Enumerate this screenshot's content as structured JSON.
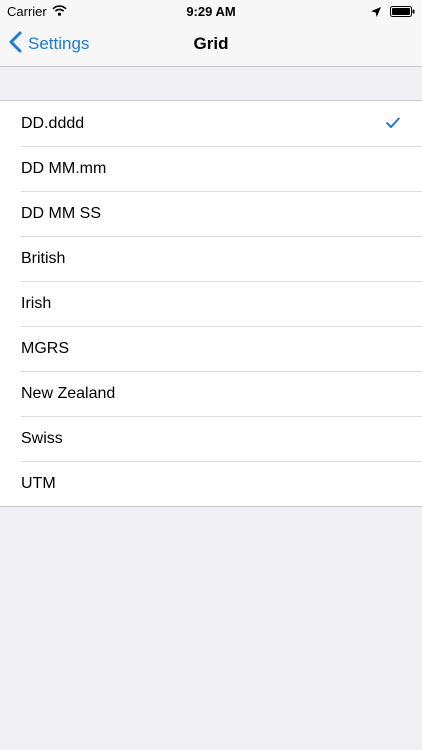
{
  "status_bar": {
    "carrier": "Carrier",
    "time": "9:29 AM",
    "icons": [
      "wifi-icon",
      "location-arrow-icon",
      "battery-icon"
    ]
  },
  "nav": {
    "back_label": "Settings",
    "title": "Grid"
  },
  "grid_options": [
    {
      "label": "DD.dddd",
      "selected": true
    },
    {
      "label": "DD MM.mm",
      "selected": false
    },
    {
      "label": "DD MM SS",
      "selected": false
    },
    {
      "label": "British",
      "selected": false
    },
    {
      "label": "Irish",
      "selected": false
    },
    {
      "label": "MGRS",
      "selected": false
    },
    {
      "label": "New Zealand",
      "selected": false
    },
    {
      "label": "Swiss",
      "selected": false
    },
    {
      "label": "UTM",
      "selected": false
    }
  ],
  "colors": {
    "accent": "#1e7ad6",
    "background": "#efeff4",
    "bar": "#f7f7f8",
    "separator": "#c8c7cc"
  }
}
